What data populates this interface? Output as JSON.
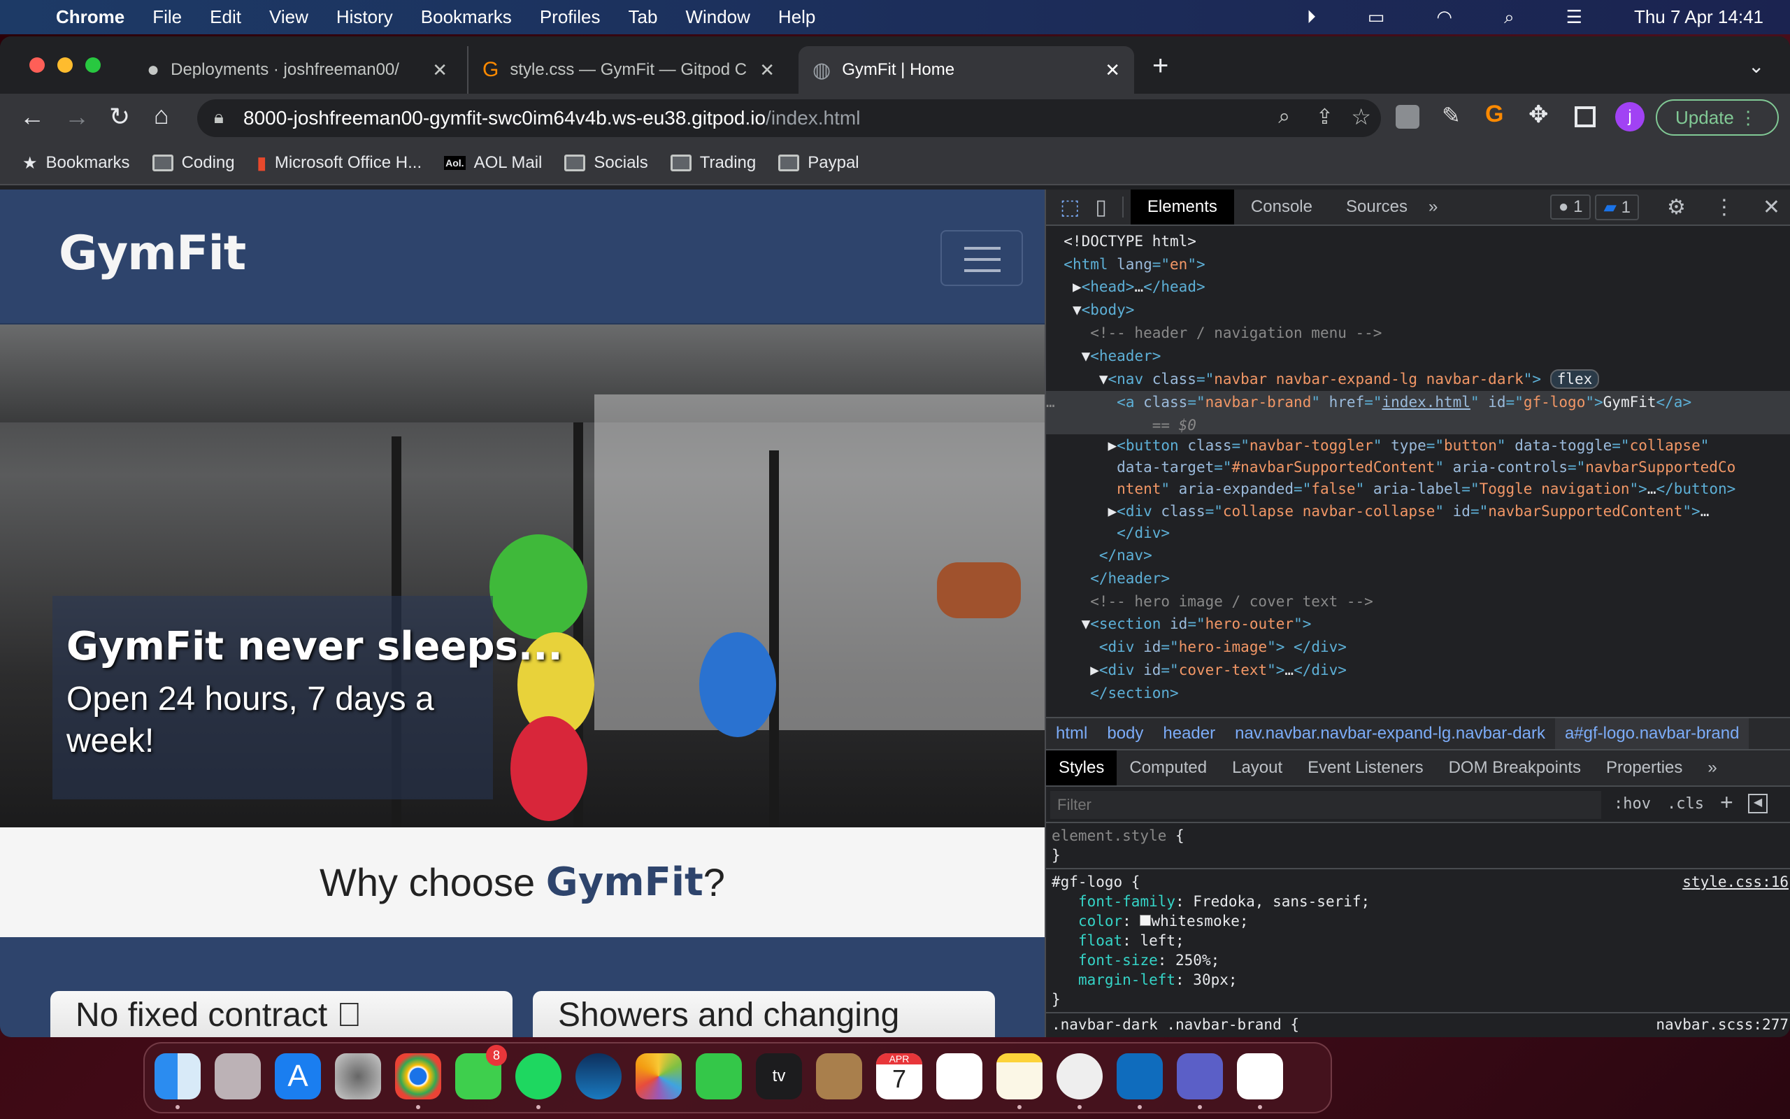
{
  "menubar": {
    "app": "Chrome",
    "items": [
      "File",
      "Edit",
      "View",
      "History",
      "Bookmarks",
      "Profiles",
      "Tab",
      "Window",
      "Help"
    ],
    "clock": "Thu 7 Apr  14:41"
  },
  "tabs": [
    {
      "title": "Deployments · joshfreeman00/",
      "icon": "github-icon"
    },
    {
      "title": "style.css — GymFit — Gitpod C",
      "icon": "gitpod-icon"
    },
    {
      "title": "GymFit | Home",
      "icon": "globe-icon",
      "active": true
    }
  ],
  "address": {
    "host": "8000-joshfreeman00-gymfit-swc0im64v4b.ws-eu38.gitpod.io",
    "path": "/index.html"
  },
  "update_label": "Update",
  "bookmarks": [
    "Bookmarks",
    "Coding",
    "Microsoft Office H...",
    "AOL Mail",
    "Socials",
    "Trading",
    "Paypal"
  ],
  "site": {
    "logo": "GymFit",
    "cover_title": "GymFit never sleeps...",
    "cover_sub": "Open 24 hours, 7 days a week!",
    "why_prefix": "Why choose ",
    "why_brand": "GymFit",
    "why_suffix": "?",
    "cards": [
      "No fixed contract",
      "Showers and changing"
    ]
  },
  "devtools": {
    "tabs": [
      "Elements",
      "Console",
      "Sources"
    ],
    "issues": "1",
    "messages": "1",
    "breadcrumbs": [
      "html",
      "body",
      "header",
      "nav.navbar.navbar-expand-lg.navbar-dark",
      "a#gf-logo.navbar-brand"
    ],
    "style_tabs": [
      "Styles",
      "Computed",
      "Layout",
      "Event Listeners",
      "DOM Breakpoints",
      "Properties"
    ],
    "filter_placeholder": "Filter",
    "hov": ":hov",
    "cls": ".cls",
    "rule1_src": "style.css:16",
    "rule2_selector": ".navbar-dark .navbar-brand {",
    "rule2_src": "navbar.scss:277"
  },
  "colors": {
    "navbar": "#2e446c",
    "devtools_bg": "#202124",
    "accent": "#7cacf8"
  },
  "dock": {
    "messages_badge": "8",
    "calendar_month": "APR",
    "calendar_day": "7"
  }
}
